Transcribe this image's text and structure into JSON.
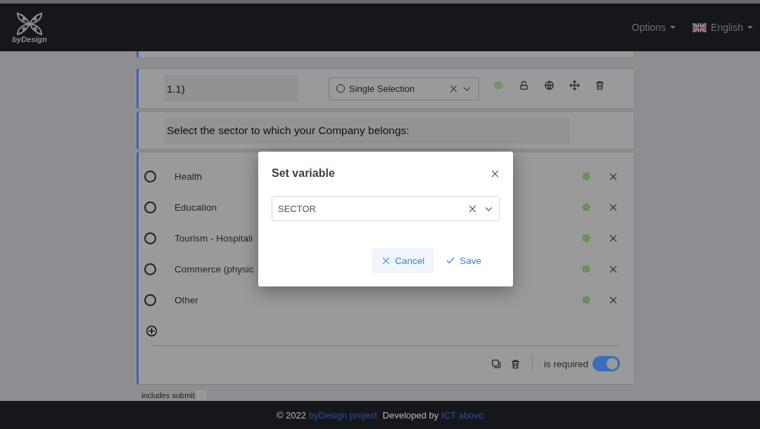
{
  "header": {
    "logo_text": "byDesign",
    "menus": [
      {
        "label": "Options",
        "kind": "plain"
      },
      {
        "label": "English",
        "kind": "language"
      }
    ]
  },
  "question": {
    "number": "1.1)",
    "type_select": {
      "value": "Single Selection"
    },
    "visible": true,
    "text": "Select the sector to which your Company belongs:",
    "options": [
      {
        "label": "Health"
      },
      {
        "label": "Education"
      },
      {
        "label": "Tourism - Hospitali"
      },
      {
        "label": "Commerce (physic"
      },
      {
        "label": "Other"
      }
    ],
    "required": {
      "label": "is required",
      "on": true
    }
  },
  "includes_submit": {
    "label": "includes submit",
    "checked": false
  },
  "dialog": {
    "title": "Set variable",
    "field": {
      "value": "SECTOR"
    },
    "buttons": [
      {
        "label": "Cancel",
        "kind": "cancel"
      },
      {
        "label": "Save",
        "kind": "save"
      }
    ]
  },
  "footer": {
    "copyright": "© 2022",
    "project_link": "byDesign project",
    "developed": "Developed by",
    "company_link": "ICT abovo"
  }
}
